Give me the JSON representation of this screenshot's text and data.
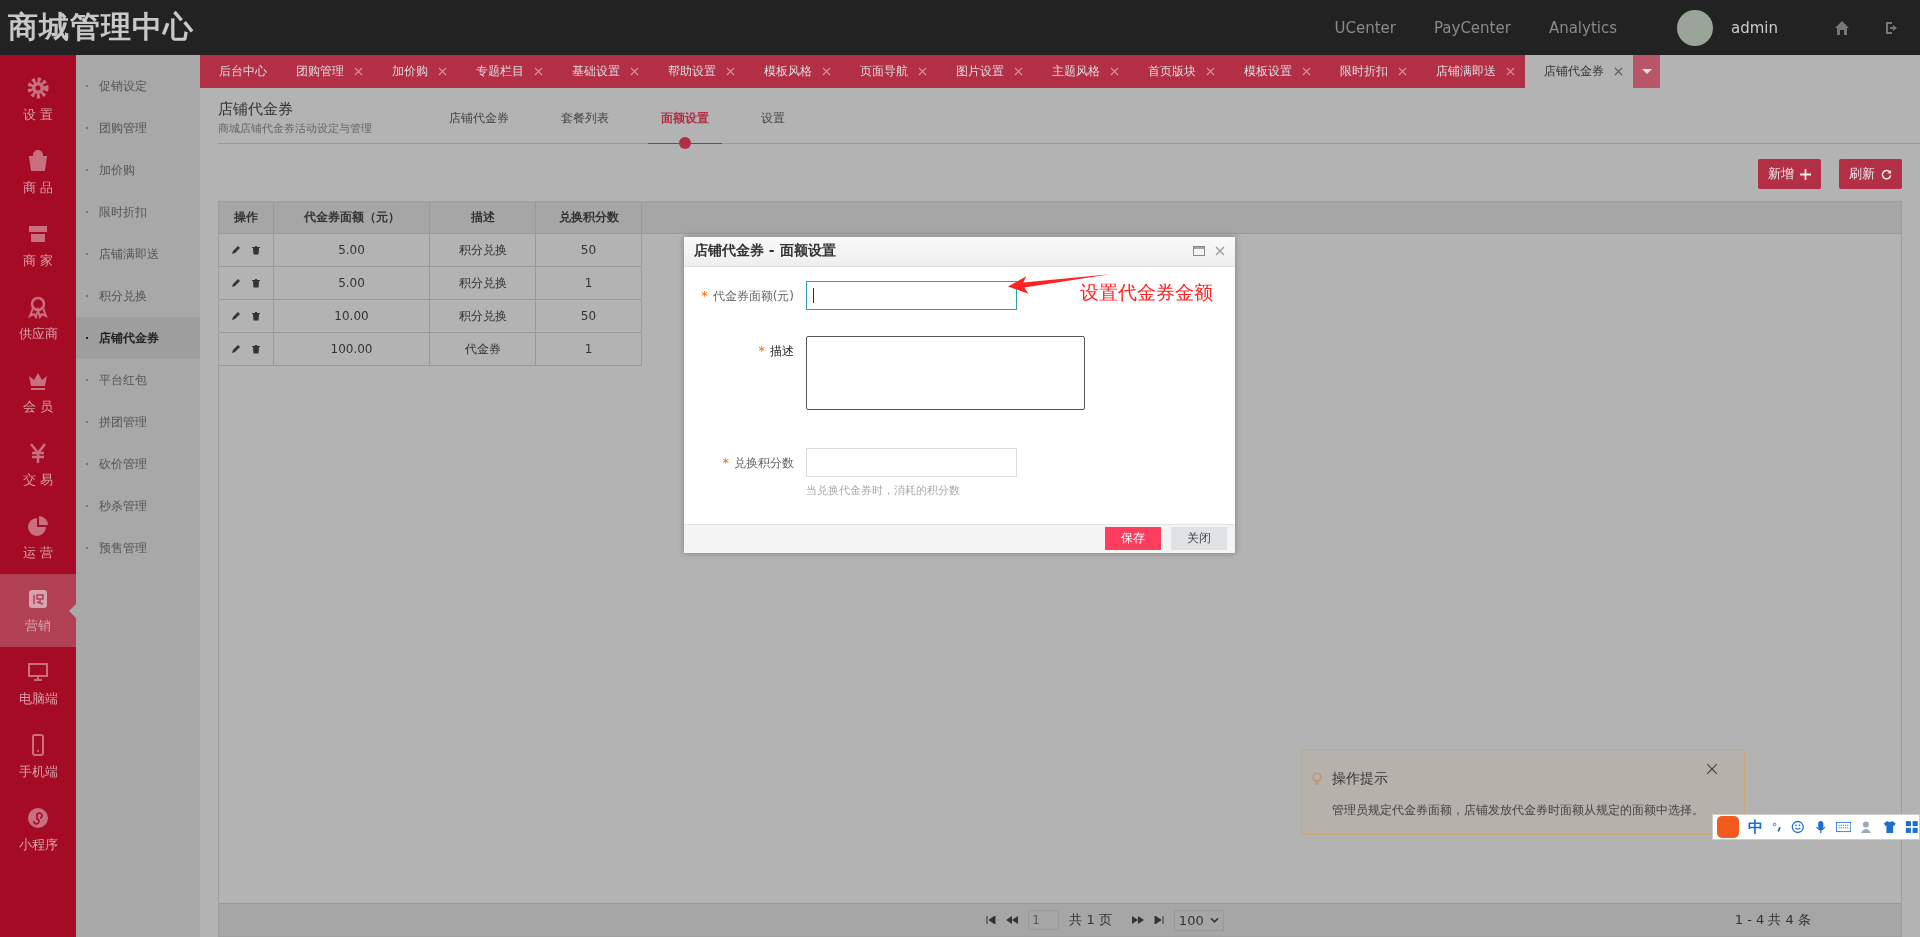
{
  "header": {
    "title": "商城管理中心",
    "links": [
      "UCenter",
      "PayCenter",
      "Analytics"
    ],
    "user": "admin"
  },
  "nav": [
    {
      "label": "设 置",
      "kind": "gear",
      "selected": false
    },
    {
      "label": "商 品",
      "kind": "bag",
      "selected": false
    },
    {
      "label": "商 家",
      "kind": "store",
      "selected": false
    },
    {
      "label": "供应商",
      "kind": "ribbon",
      "selected": false
    },
    {
      "label": "会 员",
      "kind": "crown",
      "selected": false
    },
    {
      "label": "交 易",
      "kind": "yen",
      "selected": false
    },
    {
      "label": "运 营",
      "kind": "pie",
      "selected": false
    },
    {
      "label": "营销",
      "kind": "promo",
      "selected": true
    },
    {
      "label": "电脑端",
      "kind": "monitor",
      "selected": false
    },
    {
      "label": "手机端",
      "kind": "phone",
      "selected": false
    },
    {
      "label": "小程序",
      "kind": "mini",
      "selected": false
    }
  ],
  "submenu": [
    {
      "label": "促销设定",
      "selected": false
    },
    {
      "label": "团购管理",
      "selected": false
    },
    {
      "label": "加价购",
      "selected": false
    },
    {
      "label": "限时折扣",
      "selected": false
    },
    {
      "label": "店铺满即送",
      "selected": false
    },
    {
      "label": "积分兑换",
      "selected": false
    },
    {
      "label": "店铺代金券",
      "selected": true
    },
    {
      "label": "平台红包",
      "selected": false
    },
    {
      "label": "拼团管理",
      "selected": false
    },
    {
      "label": "砍价管理",
      "selected": false
    },
    {
      "label": "秒杀管理",
      "selected": false
    },
    {
      "label": "预售管理",
      "selected": false
    }
  ],
  "tabs": [
    {
      "label": "后台中心",
      "closable": false,
      "selected": false
    },
    {
      "label": "团购管理",
      "closable": true,
      "selected": false
    },
    {
      "label": "加价购",
      "closable": true,
      "selected": false
    },
    {
      "label": "专题栏目",
      "closable": true,
      "selected": false
    },
    {
      "label": "基础设置",
      "closable": true,
      "selected": false
    },
    {
      "label": "帮助设置",
      "closable": true,
      "selected": false
    },
    {
      "label": "模板风格",
      "closable": true,
      "selected": false
    },
    {
      "label": "页面导航",
      "closable": true,
      "selected": false
    },
    {
      "label": "图片设置",
      "closable": true,
      "selected": false
    },
    {
      "label": "主题风格",
      "closable": true,
      "selected": false
    },
    {
      "label": "首页版块",
      "closable": true,
      "selected": false
    },
    {
      "label": "模板设置",
      "closable": true,
      "selected": false
    },
    {
      "label": "限时折扣",
      "closable": true,
      "selected": false
    },
    {
      "label": "店铺满即送",
      "closable": true,
      "selected": false
    },
    {
      "label": "店铺代金券",
      "closable": true,
      "selected": true
    }
  ],
  "page": {
    "title": "店铺代金券",
    "subtitle": "商城店铺代金券活动设定与管理",
    "subtabs": [
      {
        "label": "店铺代金券",
        "selected": false
      },
      {
        "label": "套餐列表",
        "selected": false
      },
      {
        "label": "面额设置",
        "selected": true
      },
      {
        "label": "设置",
        "selected": false
      }
    ]
  },
  "toolbar": [
    {
      "label": "新增",
      "kind": "plus"
    },
    {
      "label": "刷新",
      "kind": "refresh"
    }
  ],
  "table": {
    "columns": [
      "操作",
      "代金券面额（元）",
      "描述",
      "兑换积分数"
    ],
    "rows": [
      [
        "",
        "5.00",
        "积分兑换",
        "50"
      ],
      [
        "",
        "5.00",
        "积分兑换",
        "1"
      ],
      [
        "",
        "10.00",
        "积分兑换",
        "50"
      ],
      [
        "",
        "100.00",
        "代金券",
        "1"
      ]
    ]
  },
  "pagination": {
    "page": "1",
    "total_pages": "共 1 页",
    "per_page": "100",
    "summary": "1 - 4 共 4 条"
  },
  "dialog": {
    "title": "店铺代金券 - 面额设置",
    "fields": [
      {
        "label": "代金券面额(元)",
        "mark": "*",
        "kind": "input",
        "focused": true
      },
      {
        "label": "描述",
        "mark": "*",
        "kind": "textarea",
        "focused": false
      },
      {
        "label": "兑换积分数",
        "mark": "*",
        "kind": "input",
        "focused": false,
        "hint": "当兑换代金券时，消耗的积分数"
      }
    ],
    "buttons": [
      {
        "label": "保存",
        "kind": "primary"
      },
      {
        "label": "关闭",
        "kind": "default"
      }
    ]
  },
  "annotation": "设置代金券金额",
  "notice": {
    "title": "操作提示",
    "text": "管理员规定代金券面额，店铺发放代金券时面额从规定的面额中选择。"
  },
  "ime": {
    "mode": "中"
  }
}
